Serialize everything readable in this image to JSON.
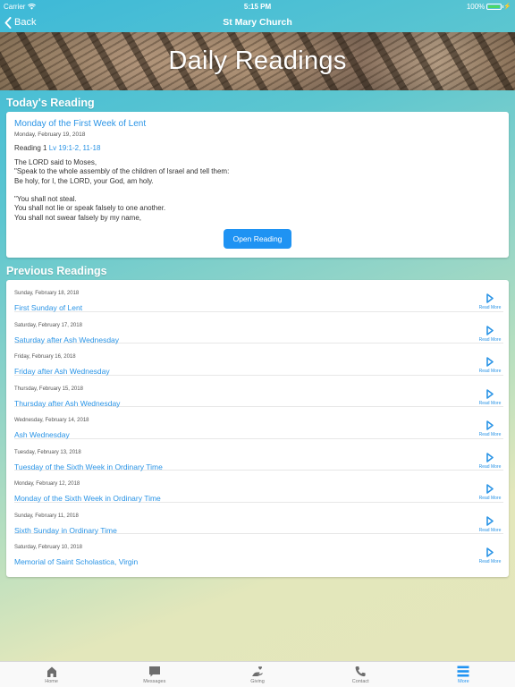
{
  "status_bar": {
    "carrier": "Carrier",
    "time": "5:15 PM",
    "battery": "100%"
  },
  "nav": {
    "back_label": "Back",
    "title": "St Mary Church"
  },
  "banner": {
    "title": "Daily Readings"
  },
  "today": {
    "section_title": "Today's Reading",
    "title": "Monday of the First Week of Lent",
    "date": "Monday, February 19, 2018",
    "reading_label": "Reading 1",
    "reading_ref": "Lv 19:1-2, 11-18",
    "body": "The LORD said to Moses,\n\"Speak to the whole assembly of the children of Israel and tell them:\nBe holy, for I, the LORD, your God, am holy.\n\n\"You shall not steal.\nYou shall not lie or speak falsely to one another.\nYou shall not swear falsely by my name,",
    "button_label": "Open Reading"
  },
  "previous": {
    "section_title": "Previous Readings",
    "read_more_label": "Read More",
    "items": [
      {
        "date": "Sunday, February 18, 2018",
        "title": "First Sunday of Lent"
      },
      {
        "date": "Saturday, February 17, 2018",
        "title": "Saturday after Ash Wednesday"
      },
      {
        "date": "Friday, February 16, 2018",
        "title": "Friday after Ash Wednesday"
      },
      {
        "date": "Thursday, February 15, 2018",
        "title": "Thursday after Ash Wednesday"
      },
      {
        "date": "Wednesday, February 14, 2018",
        "title": "Ash Wednesday"
      },
      {
        "date": "Tuesday, February 13, 2018",
        "title": "Tuesday of the Sixth Week in Ordinary Time"
      },
      {
        "date": "Monday, February 12, 2018",
        "title": "Monday of the Sixth Week in Ordinary Time"
      },
      {
        "date": "Sunday, February 11, 2018",
        "title": "Sixth Sunday in Ordinary Time"
      },
      {
        "date": "Saturday, February 10, 2018",
        "title": "Memorial of Saint Scholastica, Virgin"
      }
    ]
  },
  "tabs": [
    {
      "label": "Home",
      "icon": "home-icon",
      "active": false
    },
    {
      "label": "Messages",
      "icon": "message-icon",
      "active": false
    },
    {
      "label": "Giving",
      "icon": "giving-hand-icon",
      "active": false
    },
    {
      "label": "Contact",
      "icon": "phone-icon",
      "active": false
    },
    {
      "label": "More",
      "icon": "menu-icon",
      "active": true
    }
  ],
  "colors": {
    "accent": "#1f93f3",
    "link": "#2a94e6",
    "tab_inactive": "#777777"
  }
}
